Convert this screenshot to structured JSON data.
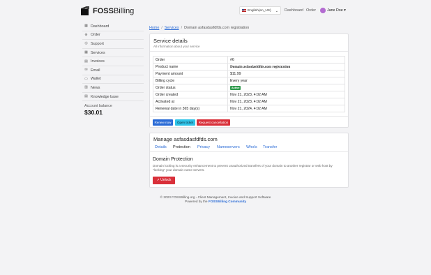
{
  "header": {
    "logo_bold": "FOSS",
    "logo_rest": "Billing",
    "language": "English(en_US)",
    "nav": [
      "Dashboard",
      "Order"
    ],
    "user_name": "Jane Doe"
  },
  "sidebar": {
    "items": [
      {
        "label": "Dashboard",
        "icon": "dashboard-icon"
      },
      {
        "label": "Order",
        "icon": "cart-icon"
      },
      {
        "label": "Support",
        "icon": "support-icon"
      },
      {
        "label": "Services",
        "icon": "services-icon"
      },
      {
        "label": "Invoices",
        "icon": "invoice-icon"
      },
      {
        "label": "Email",
        "icon": "email-icon"
      },
      {
        "label": "Wallet",
        "icon": "wallet-icon"
      },
      {
        "label": "News",
        "icon": "news-icon"
      },
      {
        "label": "Knowledge base",
        "icon": "book-icon"
      }
    ],
    "balance_label": "Account balance",
    "balance_value": "$30.01"
  },
  "breadcrumb": {
    "home": "Home",
    "services": "Services",
    "current": "Domain asfasdasfdfds.com registration"
  },
  "service_details": {
    "title": "Service details",
    "subtitle": "All information about your service",
    "rows": [
      {
        "key": "Order",
        "value": "#6"
      },
      {
        "key": "Product name",
        "value": "Domain asfasdasfdfds.com registration"
      },
      {
        "key": "Payment amount",
        "value": "$11.99"
      },
      {
        "key": "Billing cycle",
        "value": "Every year"
      },
      {
        "key": "Order status",
        "value": "Active"
      },
      {
        "key": "Order created",
        "value": "Nov 21, 2023, 4:02 AM"
      },
      {
        "key": "Activated at",
        "value": "Nov 21, 2023, 4:02 AM"
      },
      {
        "key": "Renewal date in 365 day(s)",
        "value": "Nov 21, 2024, 4:02 AM"
      }
    ],
    "buttons": {
      "renew": "Renew now",
      "ticket": "Open ticket",
      "cancel": "Request cancellation"
    }
  },
  "manage": {
    "title": "Manage asfasdasfdfds.com",
    "tabs": [
      "Details",
      "Protection",
      "Privacy",
      "Nameservers",
      "WhoIs",
      "Transfer"
    ],
    "active_tab": "Protection",
    "section_title": "Domain Protection",
    "section_text_1": "Domain locking is a security enhancement to prevent unauthorized transfers of your domain to another registrar or web host by",
    "section_text_2": "\"locking\" your domain name servers.",
    "unlock_label": "Unlock"
  },
  "footer": {
    "line1": "© 2023 FOSSBilling.org - Client Management, Invoice and Support Software",
    "line2_prefix": "Powered by the ",
    "line2_link": "FOSSBilling Community"
  },
  "colors": {
    "primary": "#2a6bd6",
    "info": "#2ec4e8",
    "danger": "#d9303a",
    "success": "#2f9a4d"
  }
}
